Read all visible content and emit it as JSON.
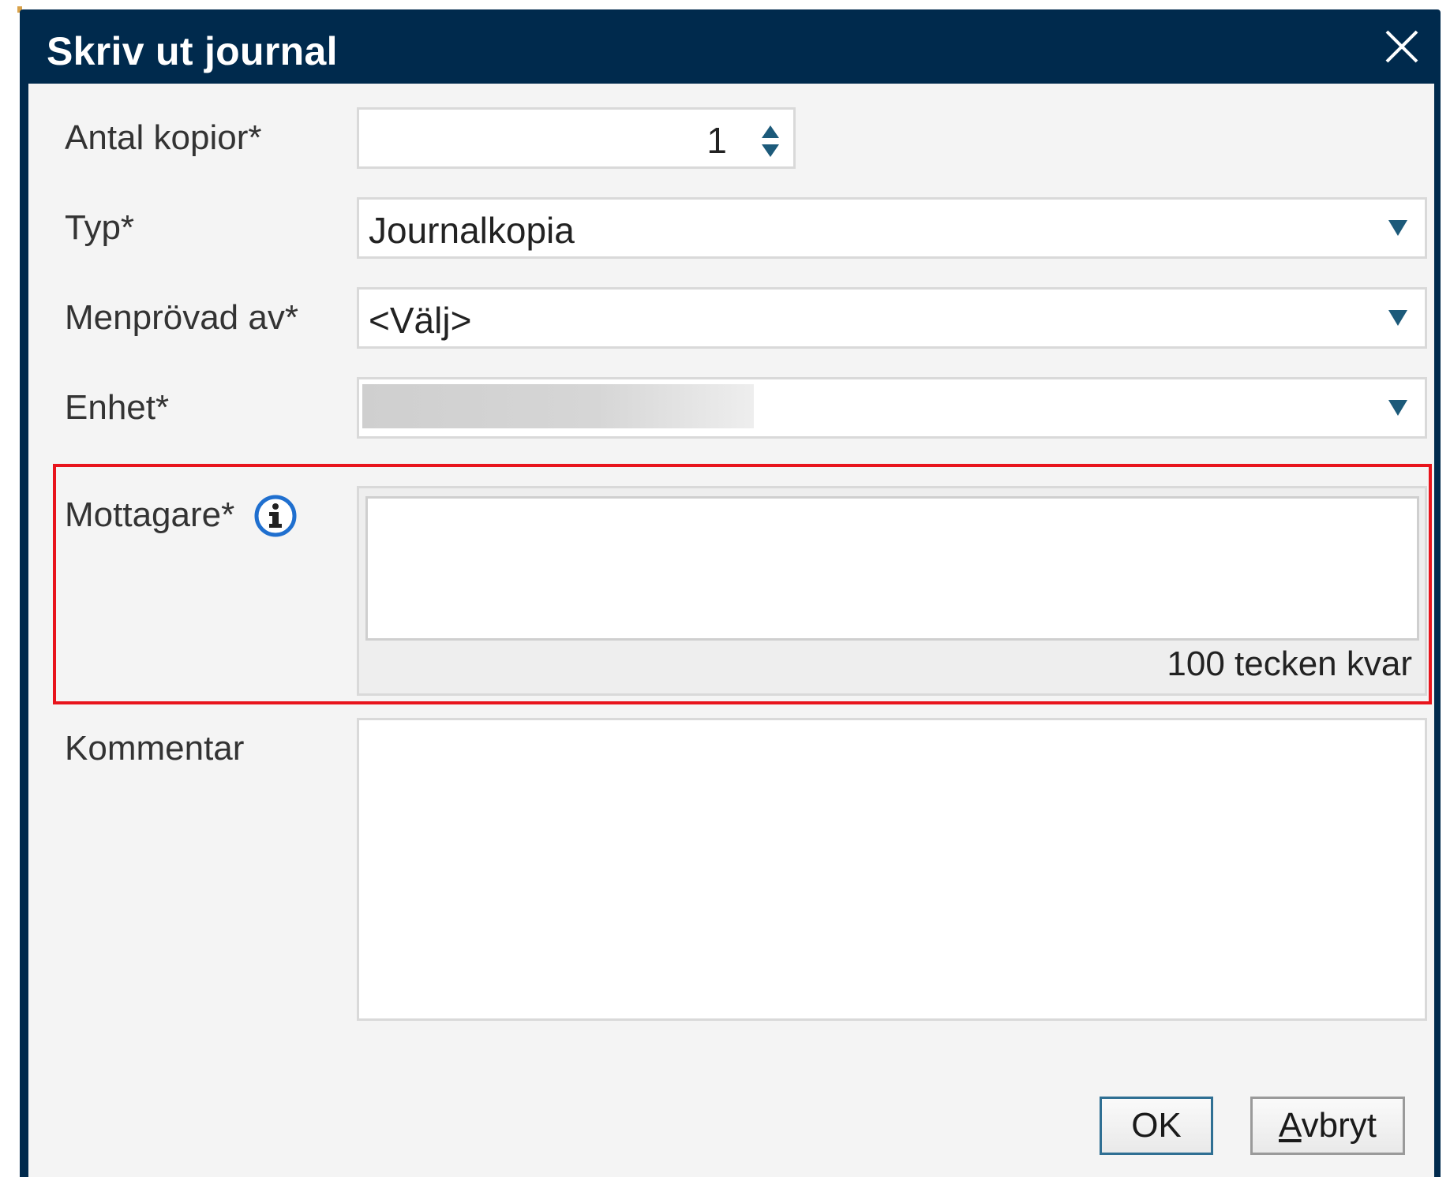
{
  "dialog": {
    "title": "Skriv ut journal",
    "close_icon": "close-icon"
  },
  "form": {
    "copies": {
      "label": "Antal kopior*",
      "value": "1"
    },
    "type": {
      "label": "Typ*",
      "value": "Journalkopia"
    },
    "reviewed_by": {
      "label": "Menprövad av*",
      "value": "<Välj>"
    },
    "unit": {
      "label": "Enhet*",
      "value": ""
    },
    "recipient": {
      "label": "Mottagare*",
      "value": "",
      "chars_left": "100 tecken kvar",
      "info_icon": "info-icon"
    },
    "comment": {
      "label": "Kommentar",
      "value": ""
    }
  },
  "buttons": {
    "ok": "OK",
    "cancel": "Avbryt"
  },
  "colors": {
    "title_bar": "#002a4d",
    "highlight": "#e8141c",
    "arrow": "#1c5a7a",
    "info": "#1f6fcf"
  }
}
